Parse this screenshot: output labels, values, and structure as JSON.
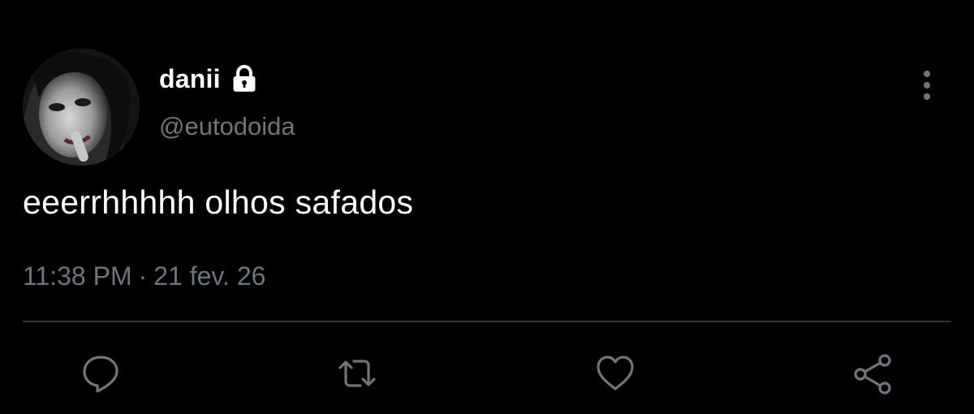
{
  "tweet": {
    "author": {
      "display_name": "danii",
      "handle": "@eutodoida",
      "avatar_icon": "profile-photo",
      "protected_icon": "lock-icon"
    },
    "text": "eeerrhhhhh olhos safados",
    "time": "11:38 PM",
    "separator": "·",
    "date": "21 fev. 26",
    "menu_icon": "more-vertical-icon",
    "actions": [
      {
        "name": "reply",
        "icon": "comment-icon"
      },
      {
        "name": "retweet",
        "icon": "retweet-icon"
      },
      {
        "name": "like",
        "icon": "heart-icon"
      },
      {
        "name": "share",
        "icon": "share-icon"
      }
    ]
  },
  "colors": {
    "background": "#000000",
    "primary_text": "#ffffff",
    "secondary_text": "#6e767d",
    "divider": "#2f3336"
  }
}
